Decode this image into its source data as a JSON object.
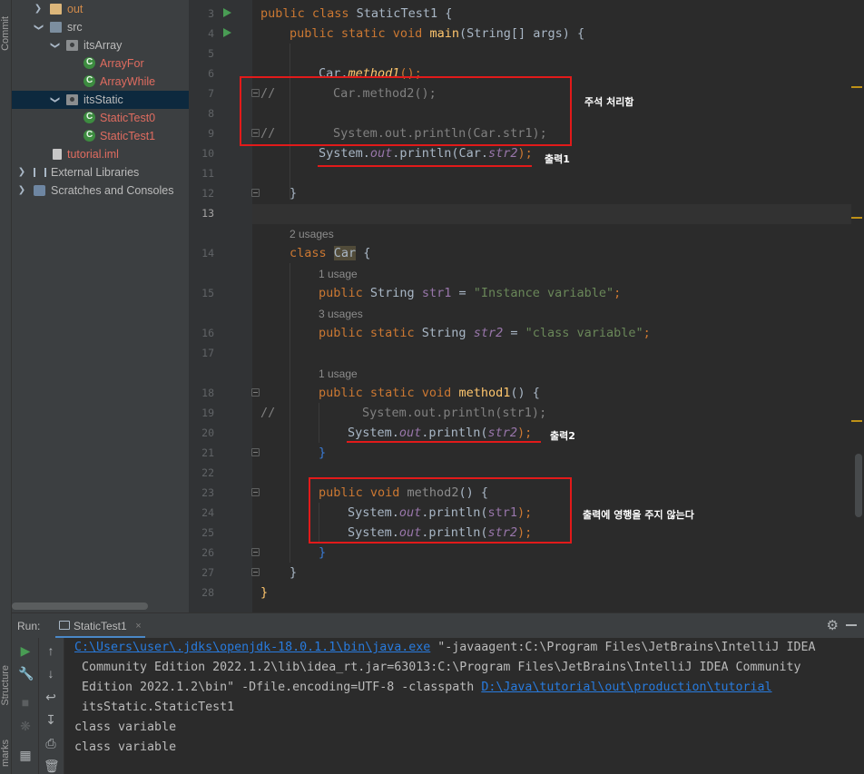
{
  "left_strip": {
    "commit_label": "Commit",
    "structure_label": "Structure",
    "bookmarks_label": "marks"
  },
  "project_tree": {
    "items": [
      {
        "label": "out"
      },
      {
        "label": "src"
      },
      {
        "label": "itsArray"
      },
      {
        "label": "ArrayFor"
      },
      {
        "label": "ArrayWhile"
      },
      {
        "label": "itsStatic"
      },
      {
        "label": "StaticTest0"
      },
      {
        "label": "StaticTest1"
      },
      {
        "label": "tutorial.iml"
      },
      {
        "label": "External Libraries"
      },
      {
        "label": "Scratches and Consoles"
      }
    ]
  },
  "editor": {
    "line_numbers": [
      "3",
      "4",
      "5",
      "6",
      "7",
      "8",
      "9",
      "10",
      "11",
      "12",
      "13",
      "14",
      "15",
      "16",
      "17",
      "18",
      "19",
      "20",
      "21",
      "22",
      "23",
      "24",
      "25",
      "26",
      "27",
      "28"
    ],
    "code": {
      "l3_kw": "public class ",
      "l3_name": "StaticTest1",
      "l3_brace": " {",
      "l4_kw": "public static void ",
      "l4_fn": "main",
      "l4_rest": "(String[] args) {",
      "l6_a": "Car.",
      "l6_b": "method1",
      "l6_c": "();",
      "l7_cmt": "//",
      "l7_code": "Car.method2();",
      "l9_cmt": "//",
      "l9_code": "System.out.println(Car.str1);",
      "l10_a": "System.",
      "l10_b": "out",
      "l10_c": ".println(Car.",
      "l10_d": "str2",
      "l10_e": ");",
      "l12": "}",
      "hint_2": "2 usages",
      "l14_kw": "class ",
      "l14_name": "Car",
      "l14_brace": " {",
      "hint_1a": "1 usage",
      "l15_kw": "public ",
      "l15_type": "String ",
      "l15_field": "str1",
      "l15_eq": " = ",
      "l15_str": "\"Instance variable\"",
      "l15_end": ";",
      "hint_3": "3 usages",
      "l16_kw": "public static ",
      "l16_type": "String ",
      "l16_field": "str2",
      "l16_eq": " = ",
      "l16_str": "\"class variable\"",
      "l16_end": ";",
      "hint_1b": "1 usage",
      "l18_kw": "public static void ",
      "l18_fn": "method1",
      "l18_rest": "() {",
      "l19_cmt": "//",
      "l19_code": "System.out.println(str1);",
      "l20_a": "System.",
      "l20_b": "out",
      "l20_c": ".println(",
      "l20_d": "str2",
      "l20_e": ");",
      "l21": "}",
      "l23_kw": "public void ",
      "l23_fn": "method2",
      "l23_rest": "() {",
      "l24_a": "System.",
      "l24_b": "out",
      "l24_c": ".println(",
      "l24_d": "str1",
      "l24_e": ");",
      "l25_a": "System.",
      "l25_b": "out",
      "l25_c": ".println(",
      "l25_d": "str2",
      "l25_e": ");",
      "l26": "}",
      "l27": "}",
      "l28": "}"
    },
    "annotations": {
      "commented_out": "주석 처리함",
      "output1": "출력1",
      "output2": "출력2",
      "no_effect": "출력에 영행을 주지 않는다"
    }
  },
  "run_panel": {
    "label": "Run:",
    "tab": "StaticTest1",
    "tab_close": "×",
    "console": {
      "java_path": "C:\\Users\\user\\.jdks\\openjdk-18.0.1.1\\bin\\java.exe",
      "cmd_1": " \"-javaagent:C:\\Program Files\\JetBrains\\IntelliJ IDEA",
      "cmd_2": " Community Edition 2022.1.2\\lib\\idea_rt.jar=63013:C:\\Program Files\\JetBrains\\IntelliJ IDEA Community",
      "cmd_3": " Edition 2022.1.2\\bin\" -Dfile.encoding=UTF-8 -classpath ",
      "classpath": "D:\\Java\\tutorial\\out\\production\\tutorial",
      "cmd_4": " itsStatic.StaticTest1",
      "output": [
        "class variable",
        "class variable"
      ]
    }
  },
  "colors": {
    "keyword": "#cc7832",
    "function": "#ffc66d",
    "string": "#6a8759",
    "field": "#9876aa",
    "comment": "#808080",
    "annotation_box": "#e21a1a",
    "link": "#287bde"
  }
}
